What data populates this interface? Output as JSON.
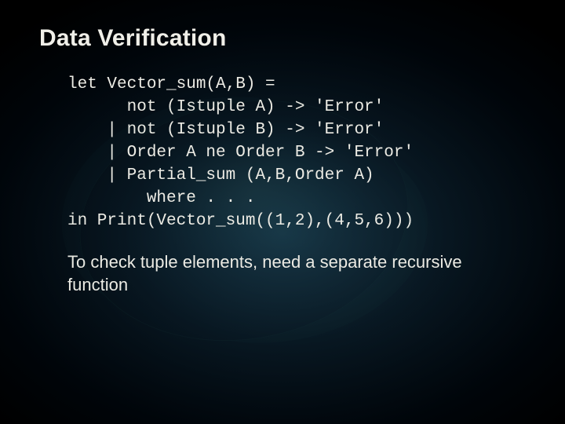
{
  "slide": {
    "title": "Data Verification",
    "code": "let Vector_sum(A,B) =\n      not (Istuple A) -> 'Error'\n    | not (Istuple B) -> 'Error'\n    | Order A ne Order B -> 'Error'\n    | Partial_sum (A,B,Order A)\n        where . . .\nin Print(Vector_sum((1,2),(4,5,6)))",
    "body": "To check tuple elements, need a separate recursive function"
  }
}
